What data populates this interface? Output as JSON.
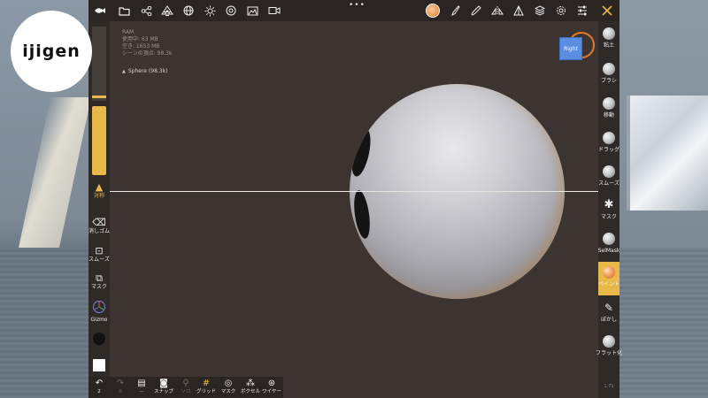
{
  "brand": {
    "logo_text": "ijigen"
  },
  "top_toolbar": {
    "icons": [
      "logo-fish-icon",
      "folder-icon",
      "scene-graph-icon",
      "topology-icon",
      "globe-icon",
      "sun-icon",
      "material-icon",
      "image-icon",
      "video-icon"
    ],
    "overflow_indicator": "•••",
    "right_icons": [
      "material-avatar",
      "paint-brush-icon",
      "picker-icon",
      "symmetry-icon",
      "topology-triangle-icon",
      "layers-icon",
      "settings-icon",
      "sliders-icon",
      "tools-icon"
    ]
  },
  "info": {
    "line1": "RAM",
    "line2": "使用中: 63 MB",
    "line3": "空き: 1653 MB",
    "line4": "シーンの頂点: 98.3k",
    "object_label": "Sphere (98.3k)"
  },
  "left_toolbar": {
    "symmetry_label": "対称",
    "eraser_label": "消しゴム",
    "smooth_label": "スムーズ",
    "mask_label": "マスク",
    "gizmo_label": "Gizmo"
  },
  "view_cube": {
    "label": "Right"
  },
  "right_tools": [
    {
      "label": "粘土"
    },
    {
      "label": "ブラシ"
    },
    {
      "label": "移動"
    },
    {
      "label": "ドラッグ"
    },
    {
      "label": "スムーズ"
    },
    {
      "label": "マスク"
    },
    {
      "label": "SelMask"
    },
    {
      "label": "ペイント",
      "active": true
    },
    {
      "label": "ぼかし"
    },
    {
      "label": "フラット化"
    }
  ],
  "right_footer": "1.71",
  "bottom_toolbar": {
    "undo_count": "2",
    "redo_count": "0",
    "items": [
      {
        "label": "···",
        "dim": false
      },
      {
        "label": "スナップ",
        "dim": false
      },
      {
        "label": "ソロ",
        "dim": true
      },
      {
        "label": "グリッド",
        "dim": false
      },
      {
        "label": "マスク",
        "dim": false
      },
      {
        "label": "ボクセル",
        "dim": false
      },
      {
        "label": "ワイヤー",
        "dim": false
      }
    ]
  },
  "colors": {
    "accent": "#e8b849",
    "active_tool": "#e8b849",
    "viewcube": "#5b8ee0",
    "ring": "#e07b28"
  }
}
